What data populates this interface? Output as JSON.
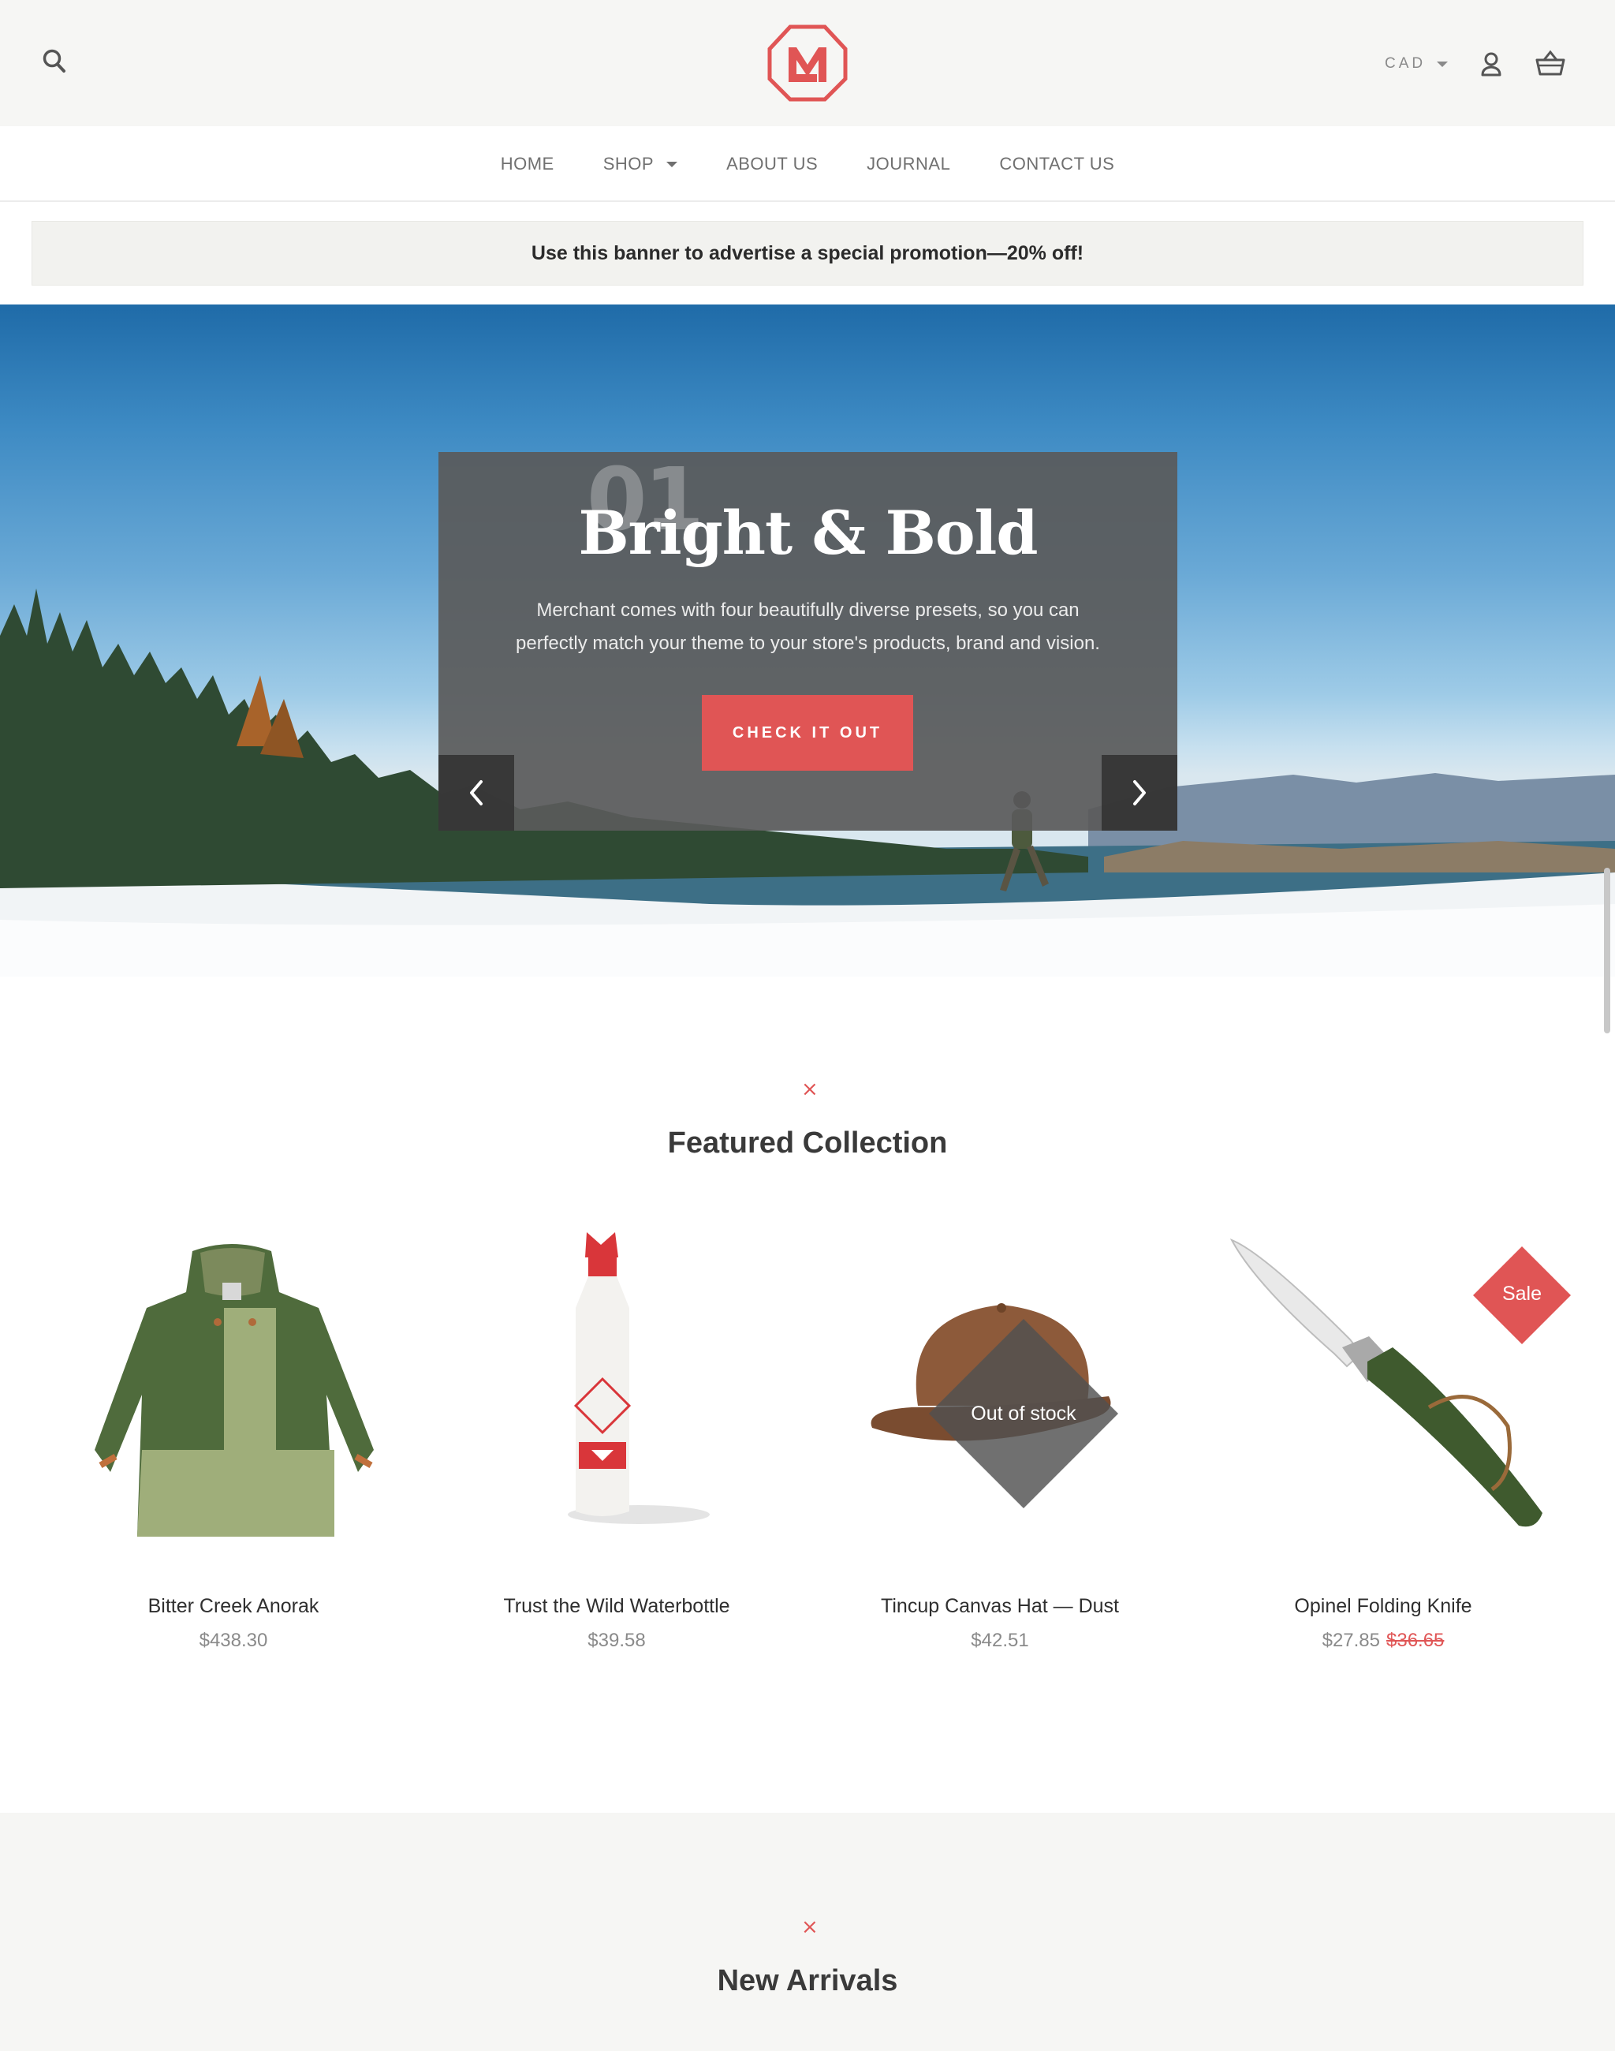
{
  "header": {
    "search_icon": "search-icon",
    "logo_letter": "M",
    "currency": "CAD",
    "account_icon": "user-icon",
    "cart_icon": "basket-icon"
  },
  "nav": {
    "items": [
      {
        "label": "HOME"
      },
      {
        "label": "SHOP",
        "has_dropdown": true
      },
      {
        "label": "ABOUT US"
      },
      {
        "label": "JOURNAL"
      },
      {
        "label": "CONTACT US"
      }
    ]
  },
  "promo": {
    "text": "Use this banner to advertise a special promotion—20% off!"
  },
  "hero": {
    "slide_number": "01",
    "title": "Bright & Bold",
    "text": "Merchant comes with four beautifully diverse presets, so you can perfectly match your theme to your store's products, brand and vision.",
    "button_label": "CHECK IT OUT",
    "prev_icon": "chevron-left-icon",
    "next_icon": "chevron-right-icon"
  },
  "featured": {
    "mark": "×",
    "title": "Featured Collection",
    "products": [
      {
        "name": "Bitter Creek Anorak",
        "price": "$438.30"
      },
      {
        "name": "Trust the Wild Waterbottle",
        "price": "$39.58"
      },
      {
        "name": "Tincup Canvas Hat — Dust",
        "price": "$42.51",
        "badge": "Out of stock"
      },
      {
        "name": "Opinel Folding Knife",
        "price": "$27.85",
        "compare_price": "$36.65",
        "badge": "Sale"
      }
    ]
  },
  "new_arrivals": {
    "mark": "×",
    "title": "New Arrivals"
  },
  "colors": {
    "accent": "#e05555",
    "header_bg": "#f6f6f4",
    "hero_panel": "#5a5a5a"
  }
}
